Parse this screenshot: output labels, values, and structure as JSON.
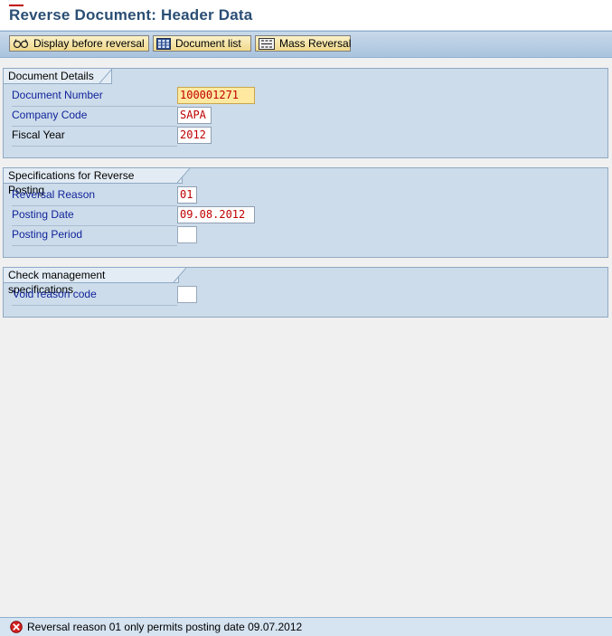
{
  "screen": {
    "title": "Reverse Document: Header Data"
  },
  "toolbar": {
    "display_before_reversal": "Display before reversal",
    "document_list": "Document list",
    "mass_reversal": "Mass Reversal"
  },
  "groups": {
    "document_details": {
      "title": "Document Details",
      "fields": [
        {
          "label": "Document Number",
          "value": "100001271"
        },
        {
          "label": "Company Code",
          "value": "SAPA"
        },
        {
          "label": "Fiscal Year",
          "value": "2012"
        }
      ]
    },
    "reverse_posting": {
      "title": "Specifications for Reverse Posting",
      "fields": [
        {
          "label": "Reversal Reason",
          "value": "01"
        },
        {
          "label": "Posting Date",
          "value": "09.08.2012"
        },
        {
          "label": "Posting Period",
          "value": ""
        }
      ]
    },
    "check_management": {
      "title": "Check management specifications",
      "fields": [
        {
          "label": "Void reason code",
          "value": ""
        }
      ]
    }
  },
  "status": {
    "type": "error",
    "icon": "error-icon",
    "message": "Reversal reason 01 only permits posting date 09.07.2012"
  },
  "colors": {
    "label_required": "#10249b",
    "field_value": "#c00000",
    "active_field": "#ffe9a0",
    "group_background": "#cddcea",
    "page_background": "#f0f0f0"
  }
}
